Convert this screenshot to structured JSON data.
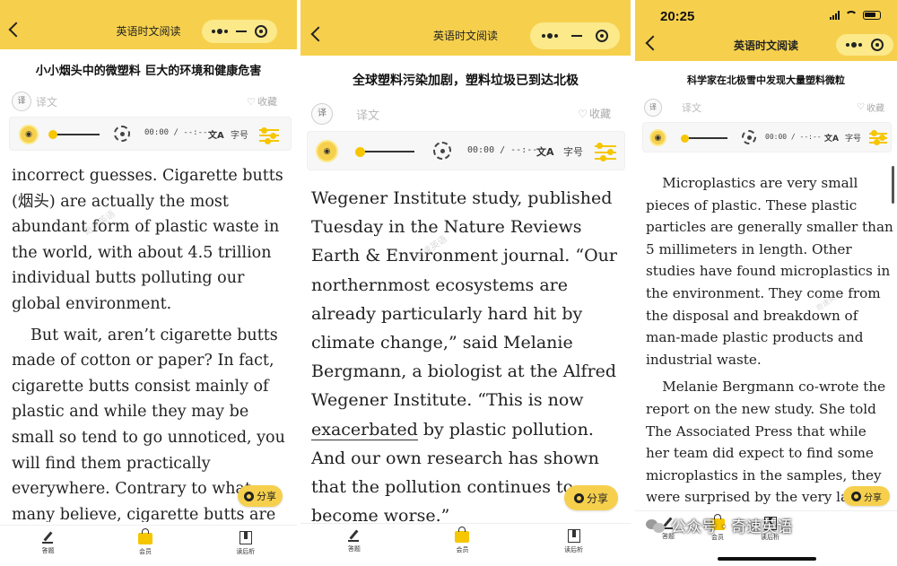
{
  "colors": {
    "accent": "#f6d04d",
    "capsule": "#fbe98a",
    "progress": "#f6c600"
  },
  "app_title": "英语时文阅读",
  "common": {
    "translate_toggle": "译",
    "translate_label": "译文",
    "favorite": "收藏",
    "audio_time": "00:00 / --:--",
    "translate_icon": "文A",
    "font_size": "字号",
    "share": "分享",
    "tabs": [
      "答题",
      "会员",
      "读后析"
    ]
  },
  "phones": [
    {
      "article_title": "小小烟头中的微塑料 巨大的环境和健康危害",
      "paragraphs": [
        "incorrect guesses. Cigarette butts (烟头) are actually the most abundant form of plastic waste in the world, with about 4.5 trillion individual butts polluting our global environment.",
        "But wait, aren’t cigarette butts made of cotton or paper? In fact, cigarette butts consist mainly of plastic and while they may be small so tend to go unnoticed, you will find them practically everywhere. Contrary to what many believe, cigarette butts are not harmless."
      ],
      "watermark": "奇速英语"
    },
    {
      "article_title": "全球塑料污染加剧，塑料垃圾已到达北极",
      "paragraphs_before": "Wegener Institute study, published Tuesday in the Nature Reviews Earth & Environment journal. “Our northernmost ecosystems are already particularly hard hit by climate change,” said Melanie Bergmann, a biologist at the Alfred Wegener Institute. “This is now ",
      "highlight_word": "exacerbated",
      "paragraphs_after": " by plastic pollution. And our own research has shown that the pollution continues to become worse.”",
      "watermark": "奇速英语"
    },
    {
      "status_time": "20:25",
      "article_title": "科学家在北极雪中发现大量塑料微粒",
      "paragraphs": [
        "Microplastics are very small pieces of plastic. These plastic particles are generally smaller than 5 millimeters in length. Other studies have found microplastics in the environment. They come from the disposal and breakdown of man-made plastic products and industrial waste.",
        "Melanie Bergmann co-wrote the report on the new study. She told The Associated Press that while her team did expect to find some microplastics in the samples, they were surprised by the very large"
      ],
      "watermark": "奇速英语"
    }
  ],
  "footer": {
    "label": "公众号 · 奇速英语",
    "icon": "wechat-icon"
  }
}
